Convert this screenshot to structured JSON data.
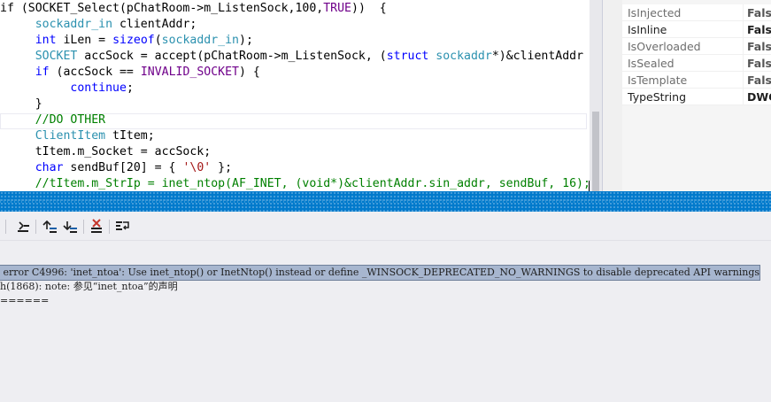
{
  "editor": {
    "lines": [
      {
        "parts": [
          [
            "",
            "if (SOCKET_Select(pChatRoom->m_ListenSock,100,"
          ],
          [
            "mc",
            "TRUE"
          ],
          [
            "",
            "))  {"
          ]
        ]
      },
      {
        "parts": [
          [
            "",
            "     "
          ],
          [
            "ty",
            "sockaddr_in"
          ],
          [
            "",
            " clientAddr;"
          ]
        ]
      },
      {
        "parts": [
          [
            "",
            "     "
          ],
          [
            "kw",
            "int"
          ],
          [
            "",
            " iLen = "
          ],
          [
            "kw",
            "sizeof"
          ],
          [
            "",
            "("
          ],
          [
            "ty",
            "sockaddr_in"
          ],
          [
            "",
            ");"
          ]
        ]
      },
      {
        "parts": [
          [
            "",
            "     "
          ],
          [
            "ty",
            "SOCKET"
          ],
          [
            "",
            " accSock = accept(pChatRoom->m_ListenSock, ("
          ],
          [
            "kw",
            "struct"
          ],
          [
            "",
            " "
          ],
          [
            "ty",
            "sockaddr"
          ],
          [
            "",
            "*)&clientAddr"
          ]
        ]
      },
      {
        "parts": [
          [
            "",
            "     "
          ],
          [
            "kw",
            "if"
          ],
          [
            "",
            " (accSock == "
          ],
          [
            "mc",
            "INVALID_SOCKET"
          ],
          [
            "",
            ") {"
          ]
        ]
      },
      {
        "parts": [
          [
            "",
            "          "
          ],
          [
            "kw",
            "continue"
          ],
          [
            "",
            ";"
          ]
        ]
      },
      {
        "parts": [
          [
            "",
            "     }"
          ]
        ]
      },
      {
        "parts": [
          [
            "",
            "     "
          ],
          [
            "cm",
            "//DO OTHER"
          ]
        ]
      },
      {
        "parts": [
          [
            "",
            "     "
          ],
          [
            "ty",
            "ClientItem"
          ],
          [
            "",
            " tItem;"
          ]
        ]
      },
      {
        "parts": [
          [
            "",
            "     tItem.m_Socket = accSock;"
          ]
        ]
      },
      {
        "parts": [
          [
            "",
            "     "
          ],
          [
            "kw",
            "char"
          ],
          [
            "",
            " sendBuf[20] = { "
          ],
          [
            "st",
            "'\\0'"
          ],
          [
            "",
            " };"
          ]
        ]
      },
      {
        "parts": [
          [
            "",
            "     "
          ],
          [
            "cm",
            "//tItem.m_StrIp = inet_ntop(AF_INET, (void*)&clientAddr.sin_addr, sendBuf, 16);"
          ]
        ]
      }
    ]
  },
  "properties": {
    "rows": [
      {
        "name": "IsInjected",
        "value": "False",
        "active": false
      },
      {
        "name": "IsInline",
        "value": "False",
        "active": true
      },
      {
        "name": "IsOverloaded",
        "value": "False",
        "active": false
      },
      {
        "name": "IsSealed",
        "value": "False",
        "active": false
      },
      {
        "name": "IsTemplate",
        "value": "False",
        "active": false
      },
      {
        "name": "TypeString",
        "value": "DWORD",
        "active": true
      }
    ]
  },
  "output": {
    "lines": [
      {
        "text": " error C4996: 'inet_ntoa': Use inet_ntop() or InetNtop() instead or define _WINSOCK_DEPRECATED_NO_WARNINGS to disable deprecated API warnings",
        "selected": true
      },
      {
        "text": "h(1868): note: 参见“inet_ntoa”的声明",
        "selected": false
      },
      {
        "text": "======",
        "selected": false
      }
    ]
  },
  "toolbar": {
    "buttons": [
      {
        "name": "find-message-in-code-icon"
      },
      {
        "name": "go-to-previous-message-icon"
      },
      {
        "name": "go-to-next-message-icon"
      },
      {
        "name": "clear-all-icon"
      },
      {
        "name": "toggle-word-wrap-icon"
      }
    ]
  },
  "colors": {
    "keyword": "#0000ff",
    "type": "#2b91af",
    "comment": "#008000",
    "string": "#a31515",
    "macro": "#6f008a",
    "tool_header": "#007acc",
    "selection": "#a7b6cf"
  }
}
